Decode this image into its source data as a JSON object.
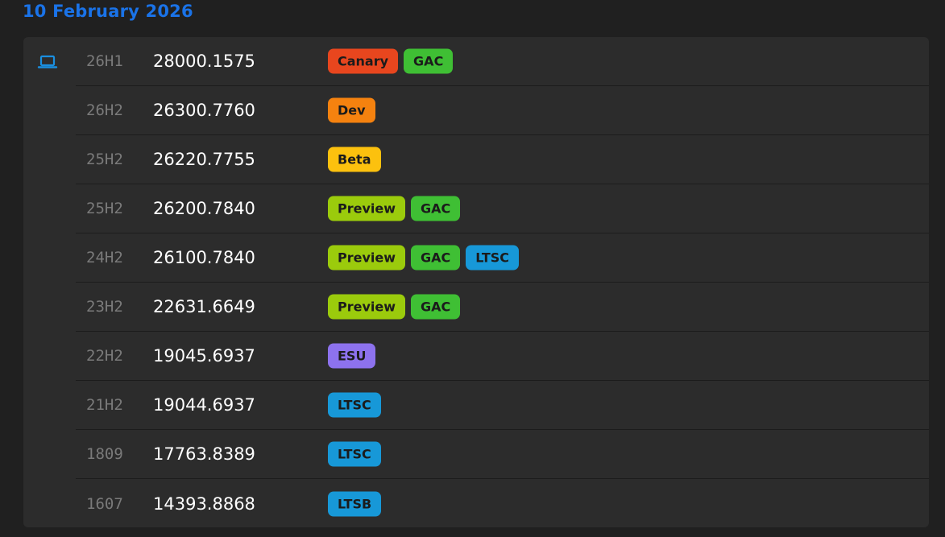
{
  "date_heading": "10 February 2026",
  "icon": "laptop-icon",
  "colors": {
    "heading": "#1a73e8",
    "canary": "#e8461e",
    "gac": "#3fbf34",
    "dev": "#f5820f",
    "beta": "#fcc10e",
    "preview": "#9bcb0c",
    "ltsc": "#1798d8",
    "esu": "#8d72ee"
  },
  "rows": [
    {
      "version": "26H1",
      "build": "28000.1575",
      "tags": [
        {
          "label": "Canary",
          "kind": "canary"
        },
        {
          "label": "GAC",
          "kind": "gac"
        }
      ]
    },
    {
      "version": "26H2",
      "build": "26300.7760",
      "tags": [
        {
          "label": "Dev",
          "kind": "dev"
        }
      ]
    },
    {
      "version": "25H2",
      "build": "26220.7755",
      "tags": [
        {
          "label": "Beta",
          "kind": "beta"
        }
      ]
    },
    {
      "version": "25H2",
      "build": "26200.7840",
      "tags": [
        {
          "label": "Preview",
          "kind": "preview"
        },
        {
          "label": "GAC",
          "kind": "gac"
        }
      ]
    },
    {
      "version": "24H2",
      "build": "26100.7840",
      "tags": [
        {
          "label": "Preview",
          "kind": "preview"
        },
        {
          "label": "GAC",
          "kind": "gac"
        },
        {
          "label": "LTSC",
          "kind": "ltsc"
        }
      ]
    },
    {
      "version": "23H2",
      "build": "22631.6649",
      "tags": [
        {
          "label": "Preview",
          "kind": "preview"
        },
        {
          "label": "GAC",
          "kind": "gac"
        }
      ]
    },
    {
      "version": "22H2",
      "build": "19045.6937",
      "tags": [
        {
          "label": "ESU",
          "kind": "esu"
        }
      ]
    },
    {
      "version": "21H2",
      "build": "19044.6937",
      "tags": [
        {
          "label": "LTSC",
          "kind": "ltsc"
        }
      ]
    },
    {
      "version": "1809",
      "build": "17763.8389",
      "tags": [
        {
          "label": "LTSC",
          "kind": "ltsc"
        }
      ]
    },
    {
      "version": "1607",
      "build": "14393.8868",
      "tags": [
        {
          "label": "LTSB",
          "kind": "ltsb"
        }
      ]
    }
  ]
}
